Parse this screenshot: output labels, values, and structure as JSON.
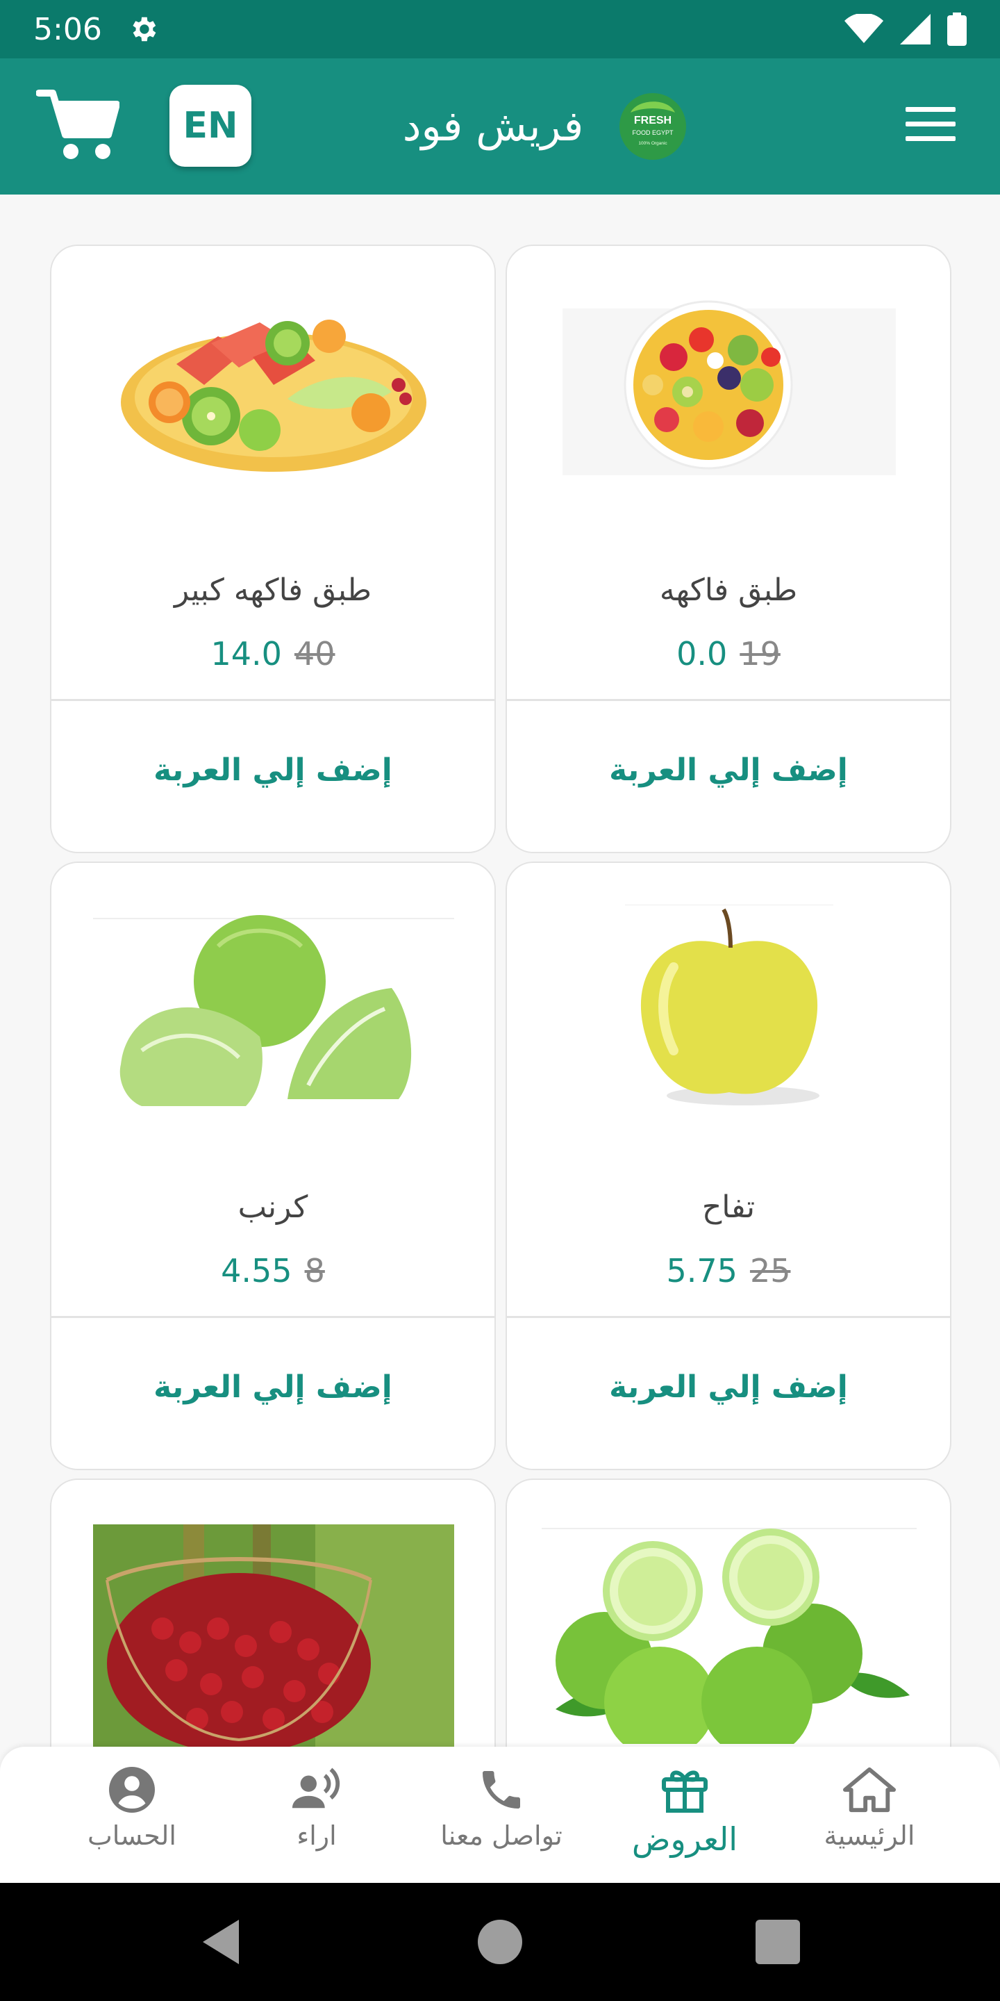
{
  "status_bar": {
    "time": "5:06"
  },
  "app_bar": {
    "title": "فريش فود",
    "lang_button": "EN",
    "logo": {
      "line1": "FRESH",
      "line2": "FOOD EGYPT",
      "line3": "100% Organic"
    }
  },
  "colors": {
    "primary": "#178f80",
    "status": "#0b7a6b",
    "muted": "#777777"
  },
  "products": [
    {
      "name": "طبق فاكهه كبير",
      "price": "14.0",
      "old_price": "40",
      "add_label": "إضف إلي العربة"
    },
    {
      "name": "طبق فاكهه",
      "price": "0.0",
      "old_price": "19",
      "add_label": "إضف إلي العربة"
    },
    {
      "name": "كرنب",
      "price": "4.55",
      "old_price": "8",
      "add_label": "إضف إلي العربة"
    },
    {
      "name": "تفاح",
      "price": "5.75",
      "old_price": "25",
      "add_label": "إضف إلي العربة"
    }
  ],
  "bottom_nav": [
    {
      "label": "الحساب",
      "icon": "account-icon"
    },
    {
      "label": "اراء",
      "icon": "feedback-icon"
    },
    {
      "label": "تواصل معنا",
      "icon": "phone-icon"
    },
    {
      "label": "العروض",
      "icon": "gift-icon",
      "active": true
    },
    {
      "label": "الرئيسية",
      "icon": "home-icon"
    }
  ]
}
